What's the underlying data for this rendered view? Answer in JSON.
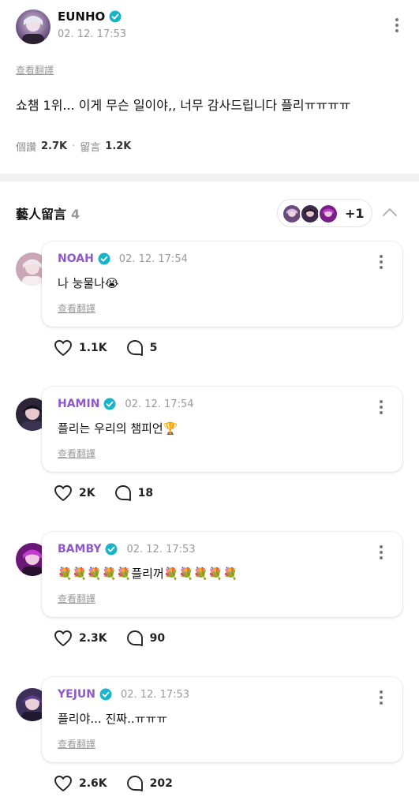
{
  "post": {
    "author": "EUNHO",
    "time": "02. 12. 17:53",
    "translate_label": "查看翻譯",
    "text": "쇼챔 1위... 이게 무슨 일이야,, 너무 감사드립니다 플리ㅠㅠㅠㅠ",
    "likes_label": "個讚",
    "likes_count": "2.7K",
    "comments_label": "留言",
    "comments_count": "1.2K",
    "avatar_icon": "artist-avatar-eunho"
  },
  "artist_comments": {
    "title": "藝人留言",
    "count": "4",
    "more_avatars": "+1"
  },
  "comments": [
    {
      "name": "NOAH",
      "time": "02. 12. 17:54",
      "text": "나 눙물나😭",
      "translate": "查看翻譯",
      "likes": "1.1K",
      "replies": "5"
    },
    {
      "name": "HAMIN",
      "time": "02. 12. 17:54",
      "text": "플리는 우리의 챔피언🏆",
      "translate": "查看翻譯",
      "likes": "2K",
      "replies": "18"
    },
    {
      "name": "BAMBY",
      "time": "02. 12. 17:53",
      "text": "💐💐💐💐💐플리꺼💐💐💐💐💐",
      "translate": "查看翻譯",
      "likes": "2.3K",
      "replies": "90"
    },
    {
      "name": "YEJUN",
      "time": "02. 12. 17:53",
      "text": "플리야... 진짜..ㅠㅠㅠ",
      "translate": "查看翻譯",
      "likes": "2.6K",
      "replies": "202"
    }
  ],
  "colors": {
    "accent_name": "#8e58c9",
    "verified_badge": "#19b4c8",
    "muted_text": "#9a9a9a",
    "section_bg": "#f2f2f4"
  }
}
